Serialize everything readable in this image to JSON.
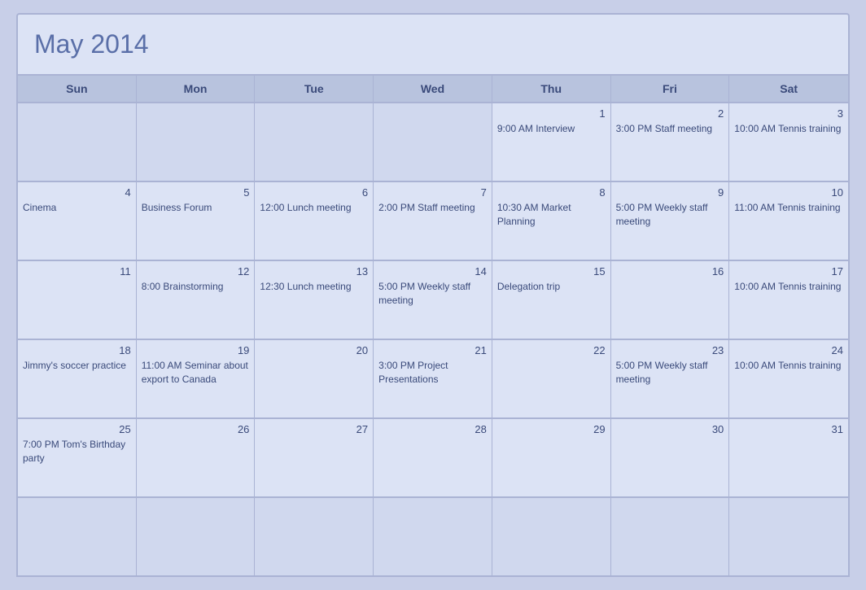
{
  "calendar": {
    "title": "May 2014",
    "headers": [
      "Sun",
      "Mon",
      "Tue",
      "Wed",
      "Thu",
      "Fri",
      "Sat"
    ],
    "weeks": [
      [
        {
          "day": "",
          "event": "",
          "empty": true
        },
        {
          "day": "",
          "event": "",
          "empty": true
        },
        {
          "day": "",
          "event": "",
          "empty": true
        },
        {
          "day": "",
          "event": "",
          "empty": true
        },
        {
          "day": "1",
          "event": "9:00 AM Interview",
          "empty": false
        },
        {
          "day": "2",
          "event": "3:00 PM Staff meeting",
          "empty": false
        },
        {
          "day": "3",
          "event": "10:00 AM Tennis training",
          "empty": false
        }
      ],
      [
        {
          "day": "4",
          "event": "Cinema",
          "empty": false
        },
        {
          "day": "5",
          "event": "Business Forum",
          "empty": false
        },
        {
          "day": "6",
          "event": "12:00 Lunch meeting",
          "empty": false
        },
        {
          "day": "7",
          "event": "2:00 PM Staff meeting",
          "empty": false
        },
        {
          "day": "8",
          "event": "10:30 AM Market Planning",
          "empty": false
        },
        {
          "day": "9",
          "event": "5:00 PM Weekly staff meeting",
          "empty": false
        },
        {
          "day": "10",
          "event": "11:00 AM Tennis training",
          "empty": false
        }
      ],
      [
        {
          "day": "11",
          "event": "",
          "empty": false
        },
        {
          "day": "12",
          "event": "8:00 Brainstorming",
          "empty": false
        },
        {
          "day": "13",
          "event": "12:30 Lunch meeting",
          "empty": false
        },
        {
          "day": "14",
          "event": "5:00 PM Weekly staff meeting",
          "empty": false
        },
        {
          "day": "15",
          "event": "Delegation trip",
          "empty": false
        },
        {
          "day": "16",
          "event": "",
          "empty": false
        },
        {
          "day": "17",
          "event": "10:00 AM Tennis training",
          "empty": false
        }
      ],
      [
        {
          "day": "18",
          "event": "Jimmy's soccer practice",
          "empty": false
        },
        {
          "day": "19",
          "event": "11:00 AM Seminar about export to Canada",
          "empty": false
        },
        {
          "day": "20",
          "event": "",
          "empty": false
        },
        {
          "day": "21",
          "event": "3:00 PM Project Presentations",
          "empty": false
        },
        {
          "day": "22",
          "event": "",
          "empty": false
        },
        {
          "day": "23",
          "event": "5:00 PM Weekly staff meeting",
          "empty": false
        },
        {
          "day": "24",
          "event": "10:00 AM Tennis training",
          "empty": false
        }
      ],
      [
        {
          "day": "25",
          "event": "7:00 PM Tom's Birthday party",
          "empty": false
        },
        {
          "day": "26",
          "event": "",
          "empty": false
        },
        {
          "day": "27",
          "event": "",
          "empty": false
        },
        {
          "day": "28",
          "event": "",
          "empty": false
        },
        {
          "day": "29",
          "event": "",
          "empty": false
        },
        {
          "day": "30",
          "event": "",
          "empty": false
        },
        {
          "day": "31",
          "event": "",
          "empty": false
        }
      ],
      [
        {
          "day": "",
          "event": "",
          "empty": true
        },
        {
          "day": "",
          "event": "",
          "empty": true
        },
        {
          "day": "",
          "event": "",
          "empty": true
        },
        {
          "day": "",
          "event": "",
          "empty": true
        },
        {
          "day": "",
          "event": "",
          "empty": true
        },
        {
          "day": "",
          "event": "",
          "empty": true
        },
        {
          "day": "",
          "event": "",
          "empty": true
        }
      ]
    ]
  }
}
